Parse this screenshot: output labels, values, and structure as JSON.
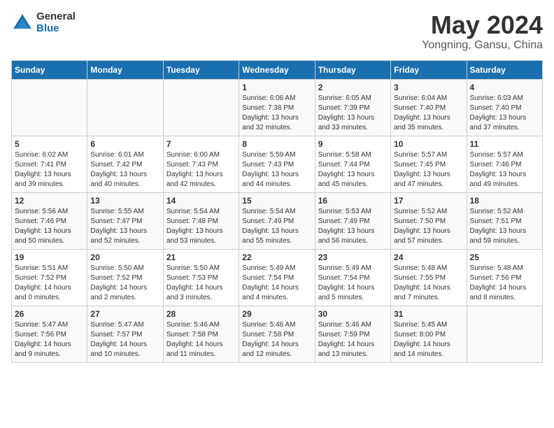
{
  "logo": {
    "general": "General",
    "blue": "Blue"
  },
  "title": "May 2024",
  "subtitle": "Yongning, Gansu, China",
  "days_header": [
    "Sunday",
    "Monday",
    "Tuesday",
    "Wednesday",
    "Thursday",
    "Friday",
    "Saturday"
  ],
  "weeks": [
    [
      {
        "day": "",
        "info": ""
      },
      {
        "day": "",
        "info": ""
      },
      {
        "day": "",
        "info": ""
      },
      {
        "day": "1",
        "info": "Sunrise: 6:06 AM\nSunset: 7:38 PM\nDaylight: 13 hours\nand 32 minutes."
      },
      {
        "day": "2",
        "info": "Sunrise: 6:05 AM\nSunset: 7:39 PM\nDaylight: 13 hours\nand 33 minutes."
      },
      {
        "day": "3",
        "info": "Sunrise: 6:04 AM\nSunset: 7:40 PM\nDaylight: 13 hours\nand 35 minutes."
      },
      {
        "day": "4",
        "info": "Sunrise: 6:03 AM\nSunset: 7:40 PM\nDaylight: 13 hours\nand 37 minutes."
      }
    ],
    [
      {
        "day": "5",
        "info": "Sunrise: 6:02 AM\nSunset: 7:41 PM\nDaylight: 13 hours\nand 39 minutes."
      },
      {
        "day": "6",
        "info": "Sunrise: 6:01 AM\nSunset: 7:42 PM\nDaylight: 13 hours\nand 40 minutes."
      },
      {
        "day": "7",
        "info": "Sunrise: 6:00 AM\nSunset: 7:43 PM\nDaylight: 13 hours\nand 42 minutes."
      },
      {
        "day": "8",
        "info": "Sunrise: 5:59 AM\nSunset: 7:43 PM\nDaylight: 13 hours\nand 44 minutes."
      },
      {
        "day": "9",
        "info": "Sunrise: 5:58 AM\nSunset: 7:44 PM\nDaylight: 13 hours\nand 45 minutes."
      },
      {
        "day": "10",
        "info": "Sunrise: 5:57 AM\nSunset: 7:45 PM\nDaylight: 13 hours\nand 47 minutes."
      },
      {
        "day": "11",
        "info": "Sunrise: 5:57 AM\nSunset: 7:46 PM\nDaylight: 13 hours\nand 49 minutes."
      }
    ],
    [
      {
        "day": "12",
        "info": "Sunrise: 5:56 AM\nSunset: 7:46 PM\nDaylight: 13 hours\nand 50 minutes."
      },
      {
        "day": "13",
        "info": "Sunrise: 5:55 AM\nSunset: 7:47 PM\nDaylight: 13 hours\nand 52 minutes."
      },
      {
        "day": "14",
        "info": "Sunrise: 5:54 AM\nSunset: 7:48 PM\nDaylight: 13 hours\nand 53 minutes."
      },
      {
        "day": "15",
        "info": "Sunrise: 5:54 AM\nSunset: 7:49 PM\nDaylight: 13 hours\nand 55 minutes."
      },
      {
        "day": "16",
        "info": "Sunrise: 5:53 AM\nSunset: 7:49 PM\nDaylight: 13 hours\nand 56 minutes."
      },
      {
        "day": "17",
        "info": "Sunrise: 5:52 AM\nSunset: 7:50 PM\nDaylight: 13 hours\nand 57 minutes."
      },
      {
        "day": "18",
        "info": "Sunrise: 5:52 AM\nSunset: 7:51 PM\nDaylight: 13 hours\nand 59 minutes."
      }
    ],
    [
      {
        "day": "19",
        "info": "Sunrise: 5:51 AM\nSunset: 7:52 PM\nDaylight: 14 hours\nand 0 minutes."
      },
      {
        "day": "20",
        "info": "Sunrise: 5:50 AM\nSunset: 7:52 PM\nDaylight: 14 hours\nand 2 minutes."
      },
      {
        "day": "21",
        "info": "Sunrise: 5:50 AM\nSunset: 7:53 PM\nDaylight: 14 hours\nand 3 minutes."
      },
      {
        "day": "22",
        "info": "Sunrise: 5:49 AM\nSunset: 7:54 PM\nDaylight: 14 hours\nand 4 minutes."
      },
      {
        "day": "23",
        "info": "Sunrise: 5:49 AM\nSunset: 7:54 PM\nDaylight: 14 hours\nand 5 minutes."
      },
      {
        "day": "24",
        "info": "Sunrise: 5:48 AM\nSunset: 7:55 PM\nDaylight: 14 hours\nand 7 minutes."
      },
      {
        "day": "25",
        "info": "Sunrise: 5:48 AM\nSunset: 7:56 PM\nDaylight: 14 hours\nand 8 minutes."
      }
    ],
    [
      {
        "day": "26",
        "info": "Sunrise: 5:47 AM\nSunset: 7:56 PM\nDaylight: 14 hours\nand 9 minutes."
      },
      {
        "day": "27",
        "info": "Sunrise: 5:47 AM\nSunset: 7:57 PM\nDaylight: 14 hours\nand 10 minutes."
      },
      {
        "day": "28",
        "info": "Sunrise: 5:46 AM\nSunset: 7:58 PM\nDaylight: 14 hours\nand 11 minutes."
      },
      {
        "day": "29",
        "info": "Sunrise: 5:46 AM\nSunset: 7:58 PM\nDaylight: 14 hours\nand 12 minutes."
      },
      {
        "day": "30",
        "info": "Sunrise: 5:46 AM\nSunset: 7:59 PM\nDaylight: 14 hours\nand 13 minutes."
      },
      {
        "day": "31",
        "info": "Sunrise: 5:45 AM\nSunset: 8:00 PM\nDaylight: 14 hours\nand 14 minutes."
      },
      {
        "day": "",
        "info": ""
      }
    ]
  ]
}
